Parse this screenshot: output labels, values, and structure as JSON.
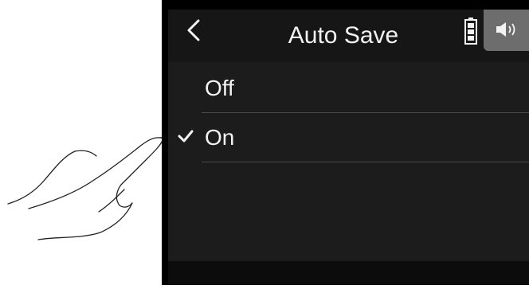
{
  "screen": {
    "title": "Auto Save",
    "back_icon": "chevron-left-icon",
    "status_icons": [
      "battery-icon",
      "speaker-icon"
    ]
  },
  "options": [
    {
      "label": "Off",
      "selected": false
    },
    {
      "label": "On",
      "selected": true
    }
  ],
  "colors": {
    "background": "#1c1c1c",
    "text": "#f2f2f2",
    "speaker_tab": "#6d6d6d",
    "divider": "#4b4b4b"
  }
}
